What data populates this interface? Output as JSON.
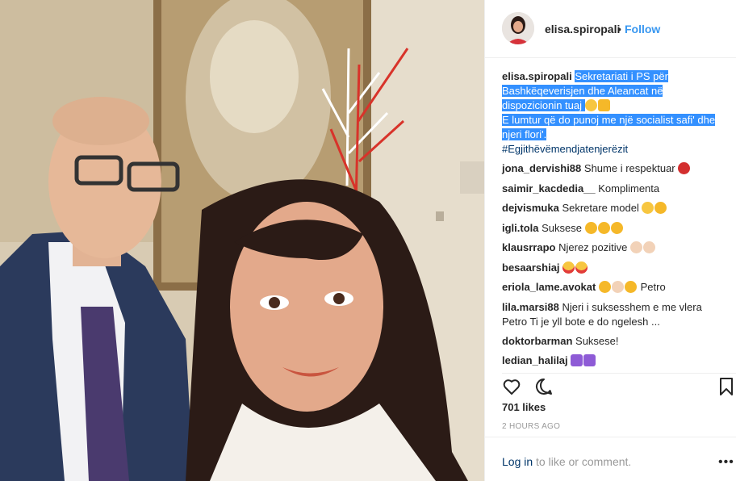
{
  "post": {
    "username": "elisa.spiropali",
    "dot": "•",
    "follow_label": "Follow",
    "caption_line1": "Sekretariati i PS për Bashkëqeverisjen dhe Aleancat në dispozicionin tuaj",
    "caption_line2": "E lumtur që do punoj me një socialist safi' dhe njeri flori'.",
    "hashtag": "#Egjithëvëmendjatenjerëzit"
  },
  "comments": [
    {
      "user": "jona_dervishi88",
      "text": "Shume i respektuar"
    },
    {
      "user": "saimir_kacdedia__",
      "text": "Komplimenta"
    },
    {
      "user": "dejvismuka",
      "text": "Sekretare model"
    },
    {
      "user": "igli.tola",
      "text": "Suksese"
    },
    {
      "user": "klausrrapo",
      "text": "Njerez pozitive"
    },
    {
      "user": "besaarshiaj",
      "text": ""
    },
    {
      "user": "eriola_lame.avokat",
      "text": "Petro"
    },
    {
      "user": "lila.marsi88",
      "text": "Njeri i suksesshem e me vlera Petro Ti je yll bote e do ngelesh ..."
    },
    {
      "user": "doktorbarman",
      "text": "Suksese!"
    },
    {
      "user": "ledian_halilaj",
      "text": ""
    }
  ],
  "stats": {
    "likes": "701 likes",
    "time": "2 HOURS AGO"
  },
  "footer": {
    "login_link": "Log in",
    "login_rest": " to like or comment.",
    "more": "•••"
  },
  "icons": {
    "like": "heart-icon",
    "comment": "comment-bubble-icon",
    "save": "bookmark-icon",
    "options": "more-options-icon"
  },
  "colors": {
    "accent": "#3897f0",
    "link": "#003569",
    "selection": "#3390ff",
    "muted": "#999999"
  }
}
